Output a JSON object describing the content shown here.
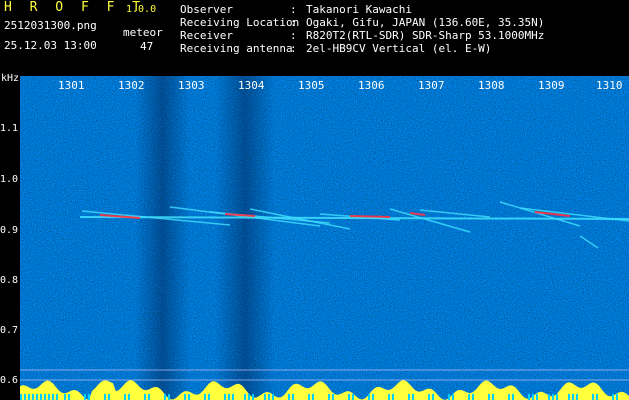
{
  "header": {
    "app_title": "H R O F F T",
    "version": "1.0.0",
    "file_name": "2512031300.png",
    "date_time": "25.12.03 13:00",
    "type_label": "meteor",
    "count": "47"
  },
  "meta": [
    {
      "key": "Observer",
      "sep": ":",
      "value": "Takanori Kawachi"
    },
    {
      "key": "Receiving Location",
      "sep": ":",
      "value": "Ogaki, Gifu, JAPAN (136.60E, 35.35N)"
    },
    {
      "key": "Receiver",
      "sep": ":",
      "value": "R820T2(RTL-SDR) SDR-Sharp 53.1000MHz"
    },
    {
      "key": "Receiving antenna",
      "sep": ":",
      "value": "2el-HB9CV Vertical (el. E-W)"
    }
  ],
  "axis": {
    "y_unit": "kHz",
    "y_ticks": [
      "1.1",
      "1.0",
      "0.9",
      "0.8",
      "0.7",
      "0.6"
    ],
    "x_ticks": [
      "1301",
      "1302",
      "1303",
      "1304",
      "1305",
      "1306",
      "1307",
      "1308",
      "1309",
      "1310"
    ]
  },
  "colors": {
    "background": "#000000",
    "noise_base": "#0a1aa0",
    "text": "#ffffff",
    "accent": "#ffff3c",
    "echo_line": "#40e0ff",
    "echo_hot": "#ff3040"
  }
}
